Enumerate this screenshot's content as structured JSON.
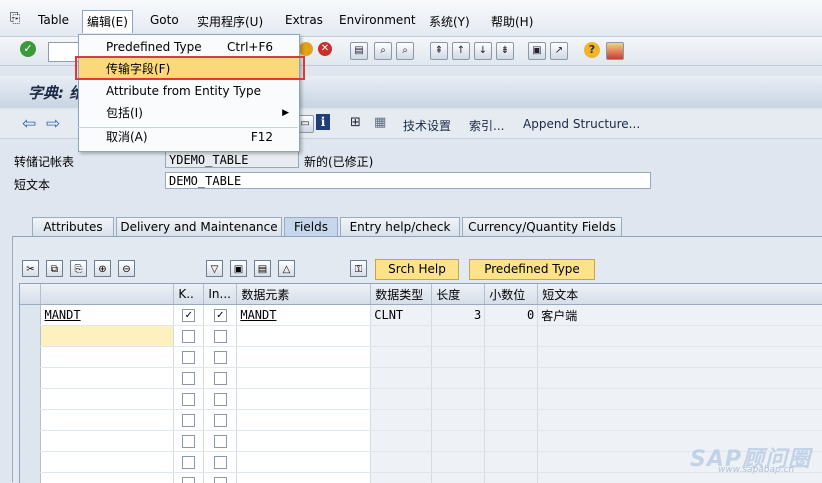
{
  "menubar": {
    "items": [
      "Table",
      "编辑(E)",
      "Goto",
      "实用程序(U)",
      "Extras",
      "Environment",
      "系统(Y)",
      "帮助(H)"
    ]
  },
  "toolbar": {
    "icons": [
      "check-icon",
      "back-icon",
      "exit-icon",
      "cancel-icon",
      "print-icon",
      "find-icon",
      "find-next-icon",
      "first-page-icon",
      "prev-page-icon",
      "next-page-icon",
      "last-page-icon",
      "new-session-icon",
      "shortcut-icon",
      "help-icon",
      "customize-icon"
    ]
  },
  "title": {
    "text": "字典: 维"
  },
  "app_toolbar": {
    "tech_settings": "技术设置",
    "index": "索引...",
    "append_structure": "Append Structure..."
  },
  "fields": {
    "table_label": "转储记帐表",
    "table_value": "YDEMO_TABLE",
    "status": "新的(已修正)",
    "short_text_label": "短文本",
    "short_text_value": "DEMO_TABLE"
  },
  "tabs": [
    {
      "label": "Attributes"
    },
    {
      "label": "Delivery and Maintenance"
    },
    {
      "label": "Fields",
      "active": true
    },
    {
      "label": "Entry help/check"
    },
    {
      "label": "Currency/Quantity Fields"
    }
  ],
  "grid_toolbar": {
    "srch_help": "Srch Help",
    "predefined_type": "Predefined Type"
  },
  "grid": {
    "columns": [
      "",
      "K..",
      "In...",
      "数据元素",
      "数据类型",
      "长度",
      "小数位",
      "短文本"
    ],
    "rows": [
      {
        "field": "MANDT",
        "key": true,
        "init": true,
        "data_element": "MANDT",
        "data_type": "CLNT",
        "length": "3",
        "decimals": "0",
        "short_text": "客户端"
      }
    ],
    "empty_rows": 8
  },
  "dropdown": {
    "items": [
      {
        "label": "Predefined Type",
        "shortcut": "Ctrl+F6"
      },
      {
        "label": "传输字段(F)",
        "highlighted": true
      },
      {
        "label": "Attribute from Entity Type"
      },
      {
        "label": "包括(I)",
        "submenu": true
      },
      {
        "label": "取消(A)",
        "shortcut": "F12"
      }
    ]
  },
  "watermark": {
    "text": "SAP顾问圈",
    "url": "www.sapabap.cn"
  }
}
